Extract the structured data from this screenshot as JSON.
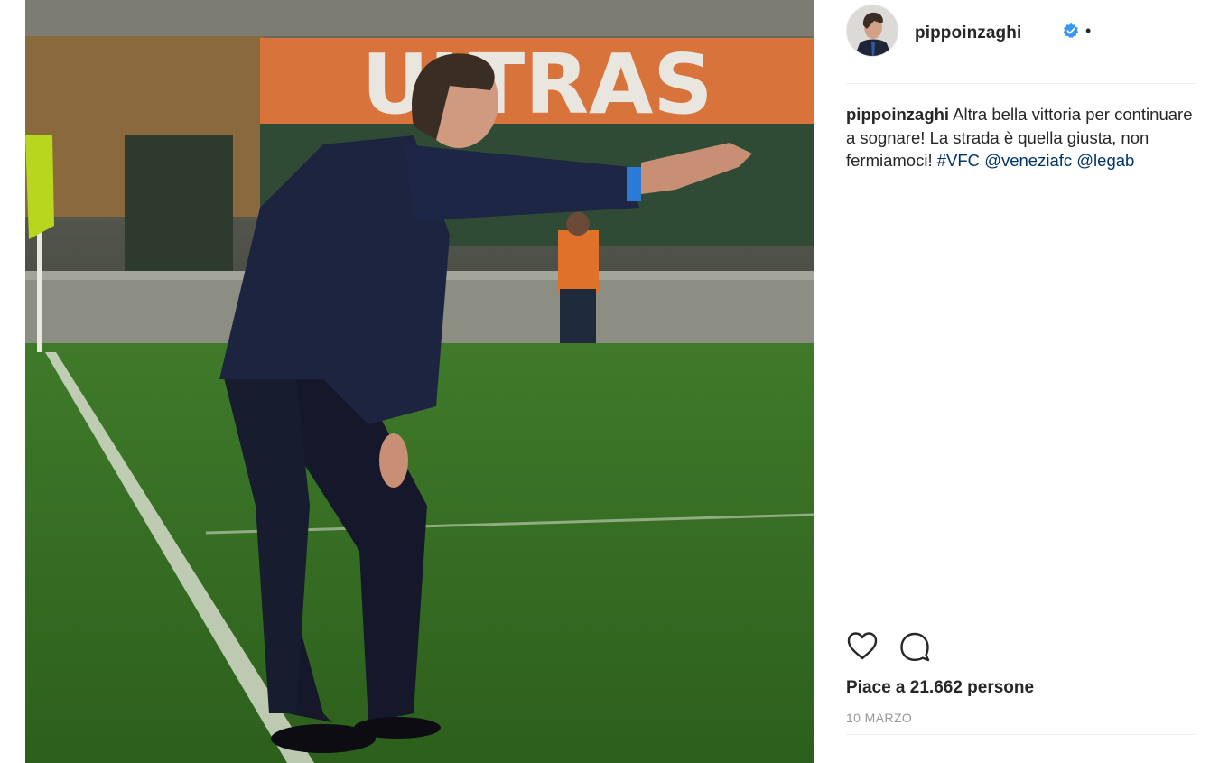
{
  "post": {
    "author": "pippoinzaghi",
    "separator": "•",
    "caption": {
      "username": "pippoinzaghi",
      "text": " Altra bella vittoria per continuare a sognare! La strada è quella giusta, non fermiamoci! ",
      "hashtag": "#VFC",
      "mention1": "@veneziafc",
      "mention2": "@legab"
    },
    "likes_text": "Piace a 21.662 persone",
    "date": "10 MARZO"
  },
  "photo": {
    "banner_text": "ULTRAS"
  },
  "colors": {
    "link": "#003569",
    "verified": "#3897f0",
    "muted": "#999999",
    "text": "#262626"
  },
  "icons": {
    "like": "heart-icon",
    "comment": "comment-bubble-icon",
    "verified": "verified-badge-icon"
  }
}
